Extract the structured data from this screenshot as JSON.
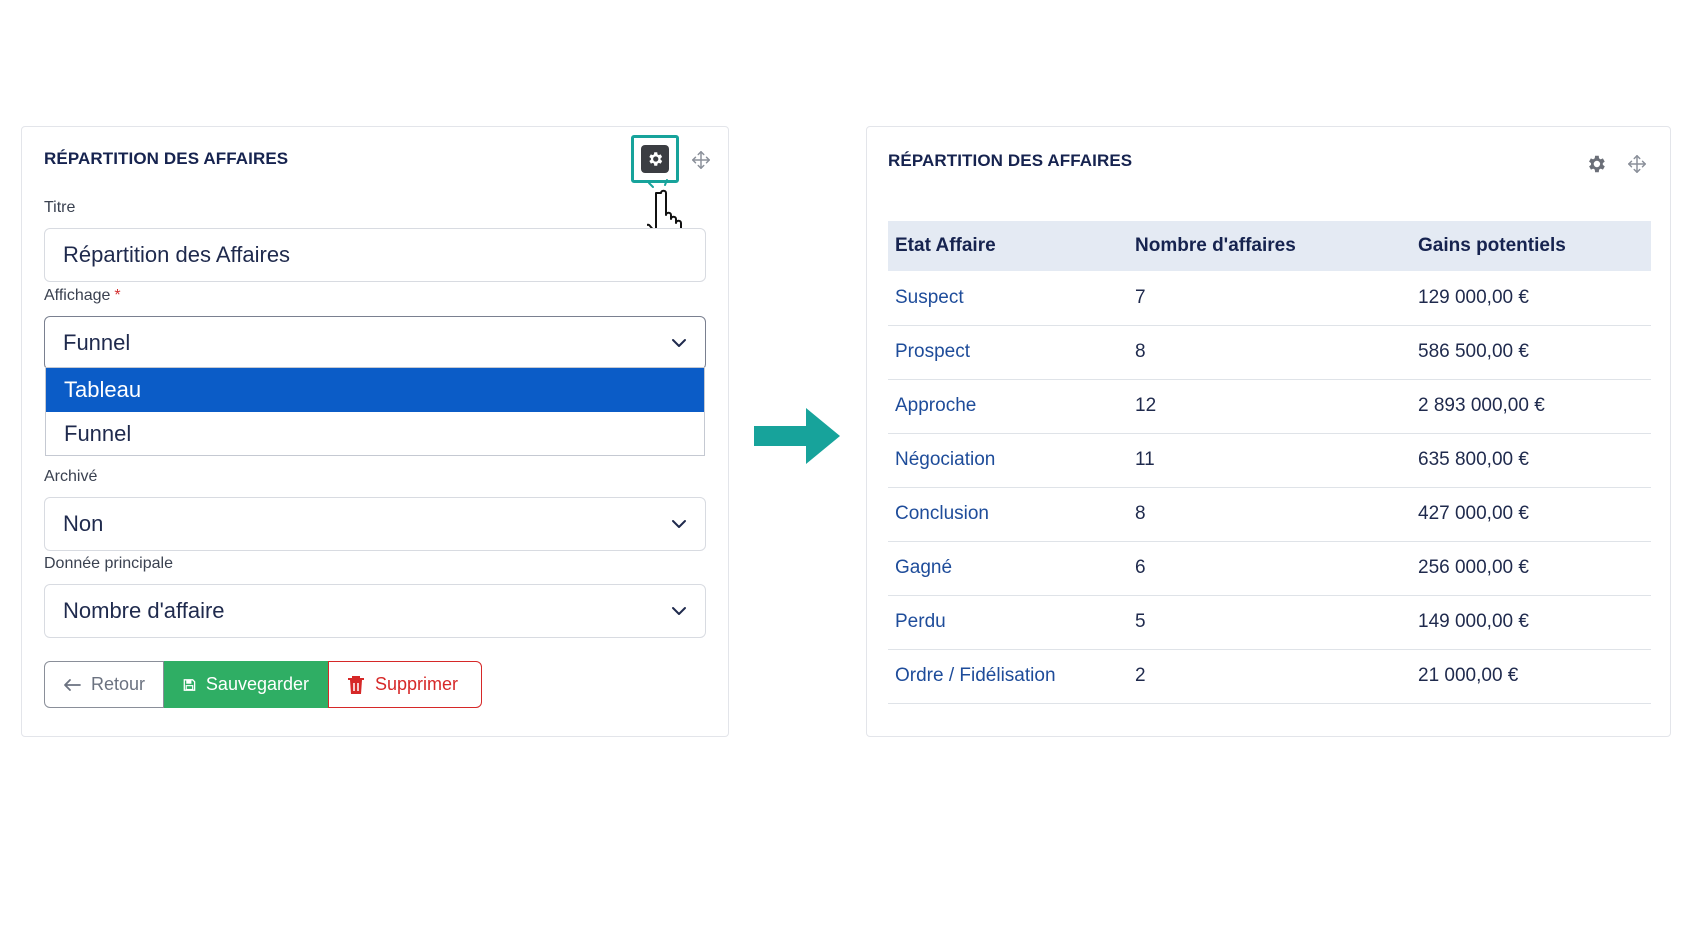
{
  "left_panel": {
    "title": "RÉPARTITION DES AFFAIRES",
    "fields": {
      "titre_label": "Titre",
      "titre_value": "Répartition des Affaires",
      "affichage_label": "Affichage",
      "affichage_required": "*",
      "affichage_value": "Funnel",
      "affichage_options": [
        "Tableau",
        "Funnel"
      ],
      "archive_label": "Archivé",
      "archive_value": "Non",
      "donnee_label": "Donnée principale",
      "donnee_value": "Nombre d'affaire"
    },
    "buttons": {
      "back": "Retour",
      "save": "Sauvegarder",
      "delete": "Supprimer"
    }
  },
  "right_panel": {
    "title": "RÉPARTITION DES AFFAIRES",
    "table": {
      "headers": [
        "Etat Affaire",
        "Nombre d'affaires",
        "Gains potentiels"
      ],
      "rows": [
        [
          "Suspect",
          "7",
          "129 000,00 €"
        ],
        [
          "Prospect",
          "8",
          "586 500,00 €"
        ],
        [
          "Approche",
          "12",
          "2 893 000,00 €"
        ],
        [
          "Négociation",
          "11",
          "635 800,00 €"
        ],
        [
          "Conclusion",
          "8",
          "427 000,00 €"
        ],
        [
          "Gagné",
          "6",
          "256 000,00 €"
        ],
        [
          "Perdu",
          "5",
          "149 000,00 €"
        ],
        [
          "Ordre / Fidélisation",
          "2",
          "21 000,00 €"
        ]
      ]
    }
  },
  "colors": {
    "accent_teal": "#17a39b",
    "selected_blue": "#0b5cc7",
    "save_green": "#2fae64",
    "delete_red": "#d62828",
    "title_navy": "#16234f"
  },
  "icons": [
    "gear-icon",
    "move-icon",
    "hand-cursor-icon",
    "chevron-down-icon",
    "arrow-left-icon",
    "floppy-disk-icon",
    "trash-icon",
    "arrow-right-icon"
  ]
}
